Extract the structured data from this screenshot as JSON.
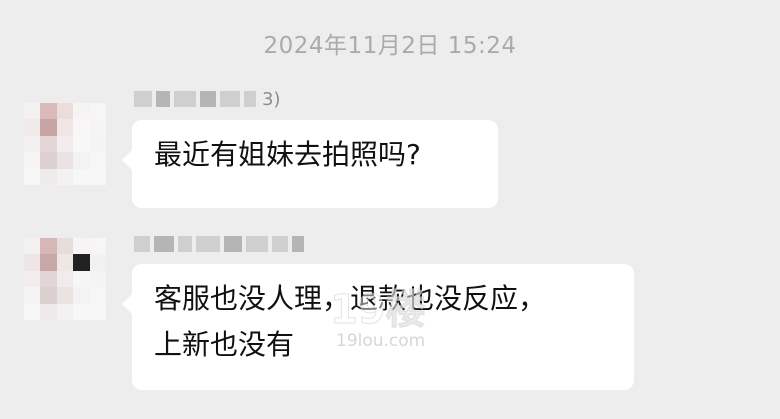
{
  "timestamp": "2024年11月2日 15:24",
  "messages": [
    {
      "sender_suffix": "3)",
      "text": "最近有姐妹去拍照吗?"
    },
    {
      "sender_suffix": "",
      "text_line1": "客服也没人理，退款也没反应，",
      "text_line2": "上新也没有"
    }
  ],
  "watermark": {
    "logo": "19楼",
    "url": "19lou.com"
  },
  "colors": {
    "background": "#ededed",
    "bubble": "#ffffff",
    "timestamp": "#aaaaaa"
  }
}
